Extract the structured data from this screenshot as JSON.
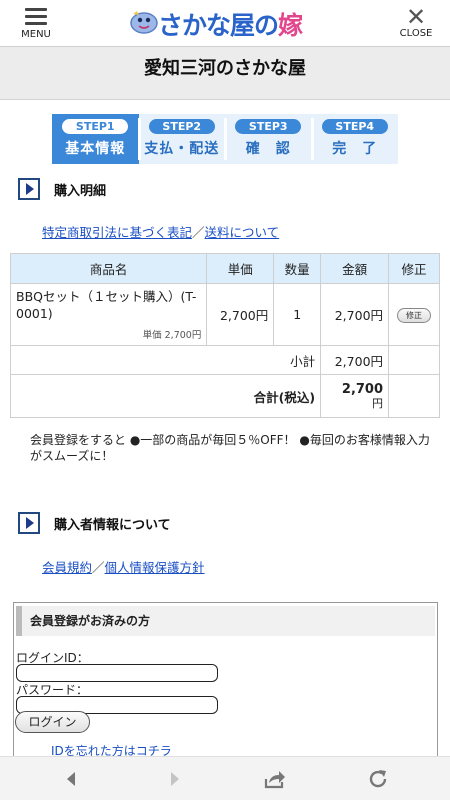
{
  "header": {
    "menu_label": "MENU",
    "close_label": "CLOSE",
    "logo_text_a": "さかな屋",
    "logo_text_b": "の",
    "logo_text_c": "嫁",
    "shop_title": "愛知三河のさかな屋"
  },
  "steps": [
    {
      "badge": "STEP1",
      "name": "基本情報",
      "active": true
    },
    {
      "badge": "STEP2",
      "name": "支払・配送",
      "active": false
    },
    {
      "badge": "STEP3",
      "name": "確　認",
      "active": false
    },
    {
      "badge": "STEP4",
      "name": "完　了",
      "active": false
    }
  ],
  "purchase": {
    "section_title": "購入明細",
    "link_law": "特定商取引法に基づく表記",
    "link_shipping": "送料について",
    "columns": [
      "商品名",
      "単価",
      "数量",
      "金額",
      "修正"
    ],
    "item": {
      "name": "BBQセット（１セット購入）(T-0001)",
      "unit_price_note": "単価 2,700円",
      "price": "2,700円",
      "qty": "1",
      "amount": "2,700円",
      "edit_label": "修正"
    },
    "subtotal_label": "小計",
    "subtotal_value": "2,700円",
    "total_label": "合計(税込)",
    "total_value": "2,700",
    "total_unit": "円"
  },
  "member_note": "会員登録をすると ●一部の商品が毎回５％OFF！ ●毎回のお客様情報入力がスムーズに！",
  "buyer": {
    "section_title": "購入者情報について",
    "link_terms": "会員規約",
    "link_privacy": "個人情報保護方針"
  },
  "login": {
    "heading": "会員登録がお済みの方",
    "id_label": "ログインID：",
    "id_value": "",
    "password_label": "パスワード：",
    "password_value": "",
    "button_label": "ログイン",
    "forgot_link": "IDを忘れた方はコチラ"
  },
  "colors": {
    "accent": "#3b87d8",
    "link": "#1a4fc4",
    "step_bg": "#e6f1fb",
    "table_head": "#dceefb"
  },
  "browser_nav": {
    "icons": [
      "back-arrow-icon",
      "forward-arrow-icon",
      "share-icon",
      "reload-icon"
    ]
  }
}
